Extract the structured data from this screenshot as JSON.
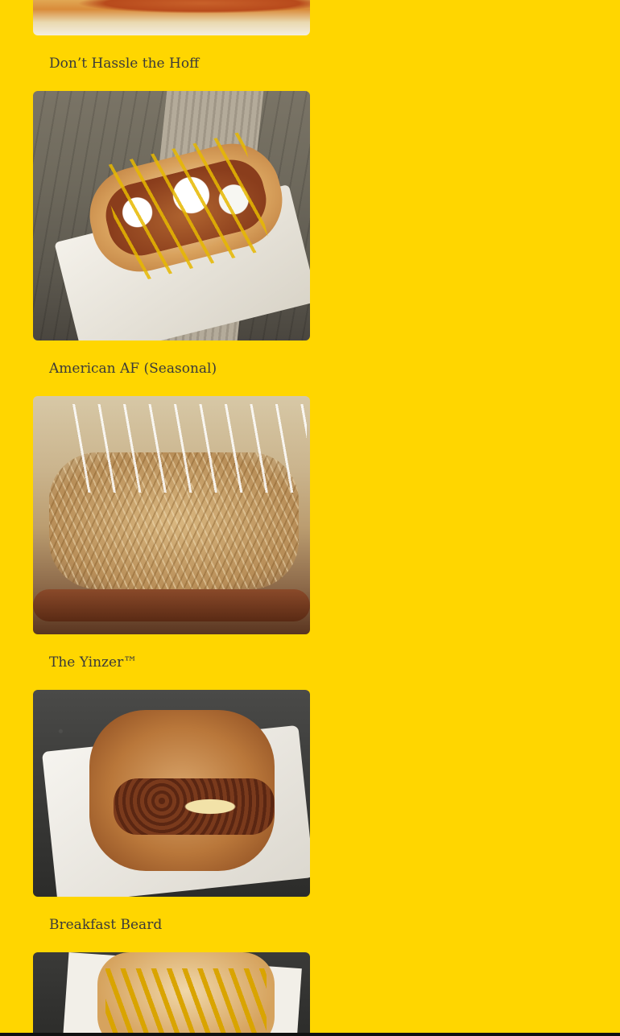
{
  "items": [
    {
      "caption": ""
    },
    {
      "caption": "Don’t Hassle the Hoff"
    },
    {
      "caption": "American AF (Seasonal)"
    },
    {
      "caption": "The Yinzer™"
    },
    {
      "caption": "Breakfast Beard"
    }
  ],
  "colors": {
    "background": "#FFD600",
    "caption_text": "#3a3a3a"
  }
}
